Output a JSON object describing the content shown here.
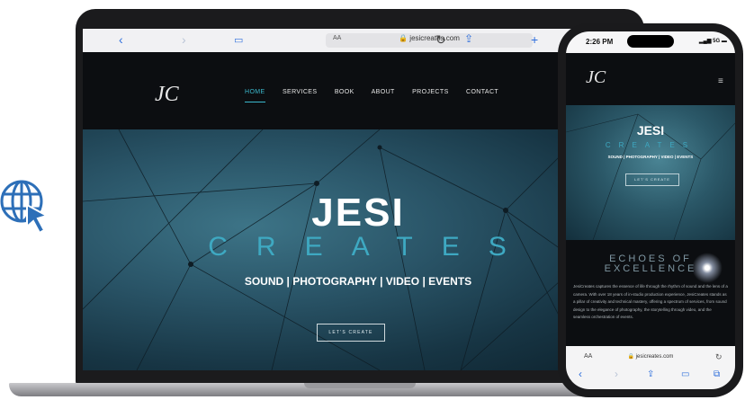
{
  "browser": {
    "aa_label": "AA",
    "url": "jesicreates.com",
    "icons": [
      "chevron-left-icon",
      "chevron-right-icon",
      "book-icon",
      "lock-icon",
      "reload-icon",
      "share-icon",
      "plus-icon"
    ]
  },
  "site": {
    "logo": "JC",
    "nav": [
      "HOME",
      "SERVICES",
      "BOOK",
      "ABOUT",
      "PROJECTS",
      "CONTACT"
    ],
    "active_nav": "HOME",
    "hero_title": "JESI",
    "hero_subtitle": "CREATES",
    "hero_tagline": "SOUND | PHOTOGRAPHY | VIDEO | EVENTS",
    "cta": "LET'S CREATE"
  },
  "phone": {
    "time": "2:26 PM",
    "signal": "5G",
    "logo": "JC",
    "hero_title": "JESI",
    "hero_subtitle": "CREATES",
    "hero_tagline": "SOUND | PHOTOGRAPHY | VIDEO | EVENTS",
    "cta": "LET'S CREATE",
    "section_title_1": "ECHOES OF",
    "section_title_2": "EXCELLENCE",
    "body": "JesiCreates captures the essence of life through the rhythm of sound and the lens of a camera. With over 18 years of in-studio production experience, JesiCreates stands as a pillar of creativity and technical mastery, offering a spectrum of services, from sound design to the elegance of photography, the storytelling through video, and the seamless orchestration of events.",
    "url_aa": "AA",
    "url": "jesicreates.com"
  },
  "colors": {
    "accent": "#3ea9c2",
    "dark": "#0c0e11",
    "link_blue": "#2f6fdc",
    "globe_blue": "#2d6fb8"
  }
}
